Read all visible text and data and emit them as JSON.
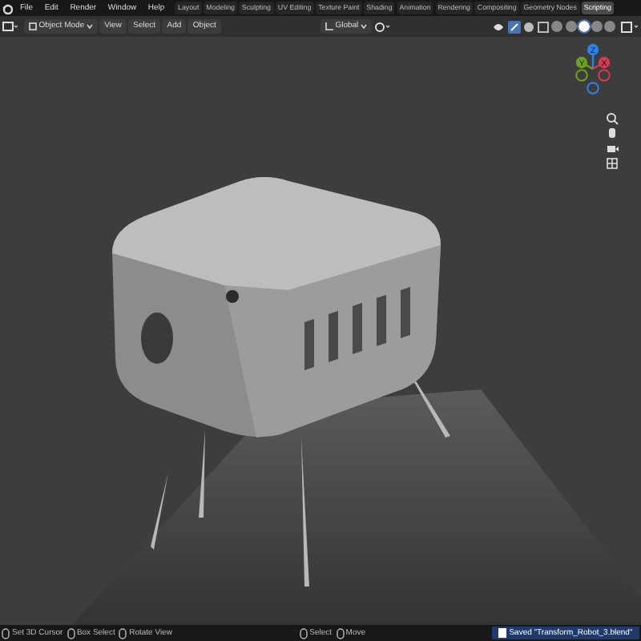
{
  "menu": [
    "File",
    "Edit",
    "Render",
    "Window",
    "Help"
  ],
  "workspaces": [
    {
      "label": "Layout",
      "selected": false
    },
    {
      "label": "Modeling",
      "selected": false
    },
    {
      "label": "Sculpting",
      "selected": false
    },
    {
      "label": "UV Editing",
      "selected": false
    },
    {
      "label": "Texture Paint",
      "selected": false
    },
    {
      "label": "Shading",
      "selected": false
    },
    {
      "label": "Animation",
      "selected": false
    },
    {
      "label": "Rendering",
      "selected": false
    },
    {
      "label": "Compositing",
      "selected": false
    },
    {
      "label": "Geometry Nodes",
      "selected": false
    },
    {
      "label": "Scripting",
      "selected": true
    }
  ],
  "header": {
    "mode": "Object Mode",
    "menus": [
      "View",
      "Select",
      "Add",
      "Object"
    ],
    "orientation": "Global"
  },
  "shading_modes": [
    {
      "selected": false
    },
    {
      "selected": false
    },
    {
      "selected": true
    },
    {
      "selected": false
    },
    {
      "selected": false
    }
  ],
  "gizmo": {
    "axes": [
      {
        "label": "Z",
        "color": "#2f83e6"
      },
      {
        "label": "Y",
        "color": "#6ea21f"
      },
      {
        "label": "X",
        "color": "#d33b4f"
      }
    ]
  },
  "status_bar": {
    "hints": [
      "Set 3D Cursor",
      "Box Select",
      "Rotate View",
      "Select",
      "Move"
    ],
    "message": "Saved \"Transform_Robot_3.blend\""
  }
}
